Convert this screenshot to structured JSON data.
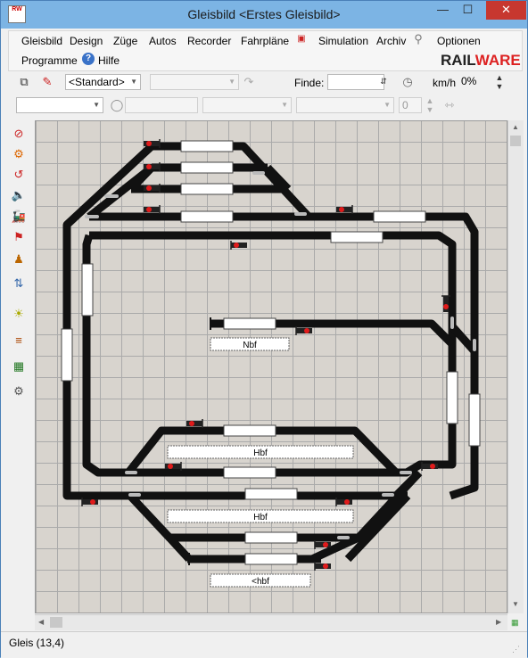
{
  "window": {
    "title": "Gleisbild <Erstes Gleisbild>",
    "icon_label": "RW",
    "controls": {
      "minimize": "—",
      "maximize": "☐",
      "close": "✕"
    }
  },
  "menu": {
    "items": [
      "Gleisbild",
      "Design",
      "Züge",
      "Autos",
      "Recorder",
      "Fahrpläne",
      "Simulation",
      "Archiv",
      "Optionen",
      "Programme",
      "Hilfe"
    ],
    "brand_prefix": "RAIL",
    "brand_suffix": "WARE"
  },
  "toolbar1": {
    "layout_select": "<Standard>",
    "find_label": "Finde:",
    "find_value": "",
    "speed_unit": "km/h",
    "speed_value": "0%"
  },
  "toolbar2": {
    "number_value": "0"
  },
  "canvas": {
    "labels": {
      "nbf": "Nbf",
      "hbf1": "Hbf",
      "hbf2": "Hbf",
      "hbf3": "<hbf"
    }
  },
  "status": {
    "text": "Gleis (13,4)"
  },
  "colors": {
    "titlebar": "#7cb4e4",
    "track": "#111111",
    "canvas": "#d8d4ce",
    "signal_red": "#e01b1b",
    "close": "#c7372f"
  }
}
